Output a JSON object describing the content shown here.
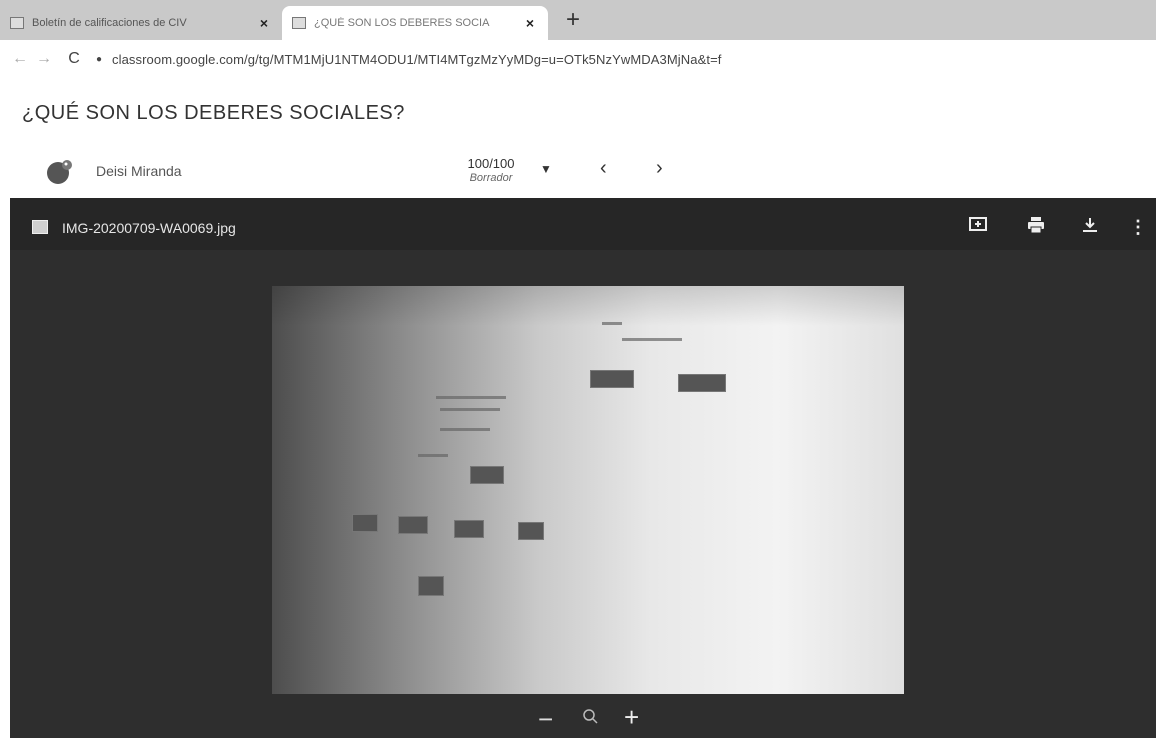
{
  "browser": {
    "tabs": [
      {
        "title": "Boletín de calificaciones de CIV"
      },
      {
        "title": "¿QUÉ SON LOS DEBERES SOCIA"
      }
    ],
    "new_tab_label": "+",
    "url": "classroom.google.com/g/tg/MTM1MjU1NTM4ODU1/MTI4MTgzMzYyMDg=u=OTk5NzYwMDA3MjNa&t=f"
  },
  "assignment": {
    "title": "¿QUÉ SON LOS DEBERES SOCIALES?",
    "student_name": "Deisi Miranda",
    "grade": "100/100",
    "grade_status": "Borrador"
  },
  "viewer": {
    "file_name": "IMG-20200709-WA0069.jpg",
    "icons": [
      "add-comment-icon",
      "print-icon",
      "download-icon",
      "more-vert-icon"
    ],
    "zoom_controls": [
      "zoom-out-icon",
      "zoom-icon",
      "zoom-in-icon"
    ]
  },
  "colors": {
    "tabbar_bg": "#c9c9c9",
    "viewer_bg": "#2e2e2e",
    "viewer_header_bg": "#262626"
  }
}
